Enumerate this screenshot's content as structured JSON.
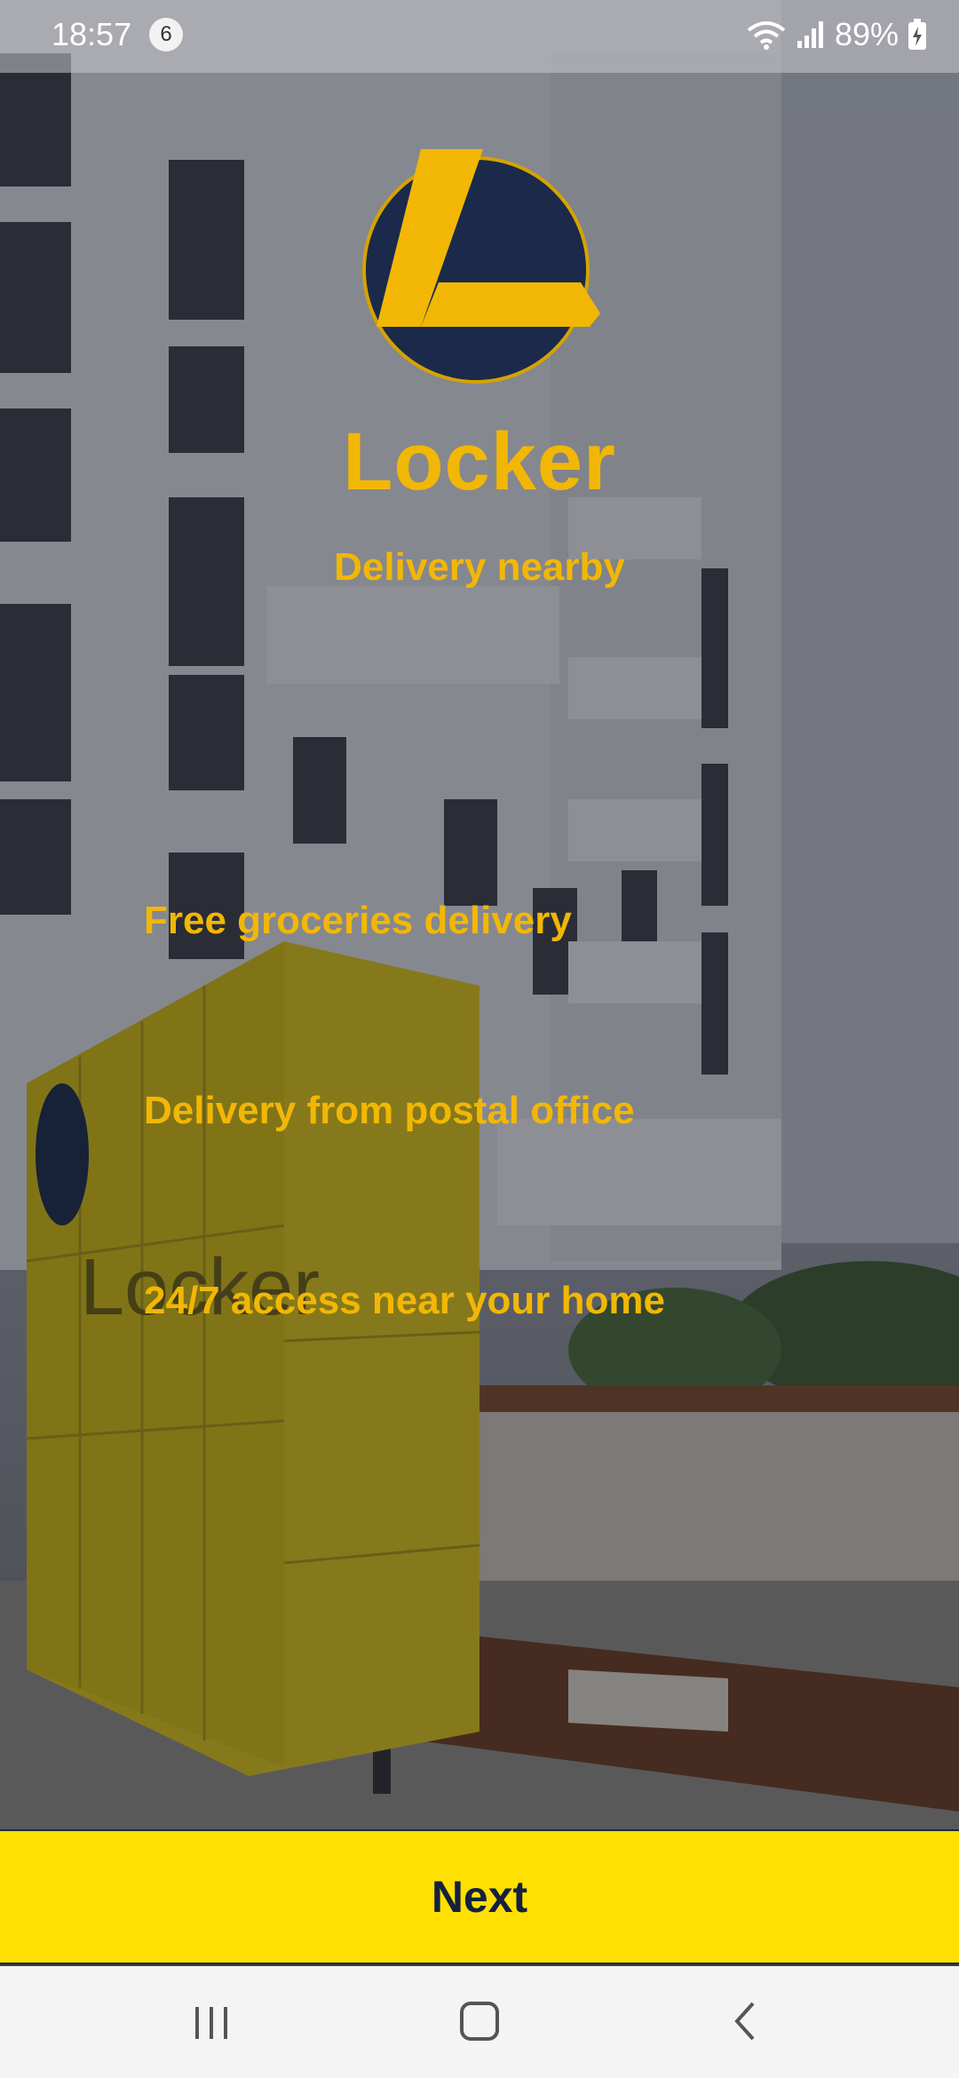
{
  "status_bar": {
    "time": "18:57",
    "notification_count": "6",
    "battery": "89%"
  },
  "app": {
    "title": "Locker",
    "subtitle": "Delivery nearby",
    "brand_colors": {
      "primary_yellow": "#f2b705",
      "navy": "#1b2a4a",
      "button_yellow": "#ffe000"
    }
  },
  "features": [
    "Free groceries delivery",
    "Delivery from postal office",
    "24/7 access near your home"
  ],
  "actions": {
    "next_label": "Next"
  },
  "nav": {
    "recents_icon": "recents-icon",
    "home_icon": "home-icon",
    "back_icon": "back-icon"
  }
}
